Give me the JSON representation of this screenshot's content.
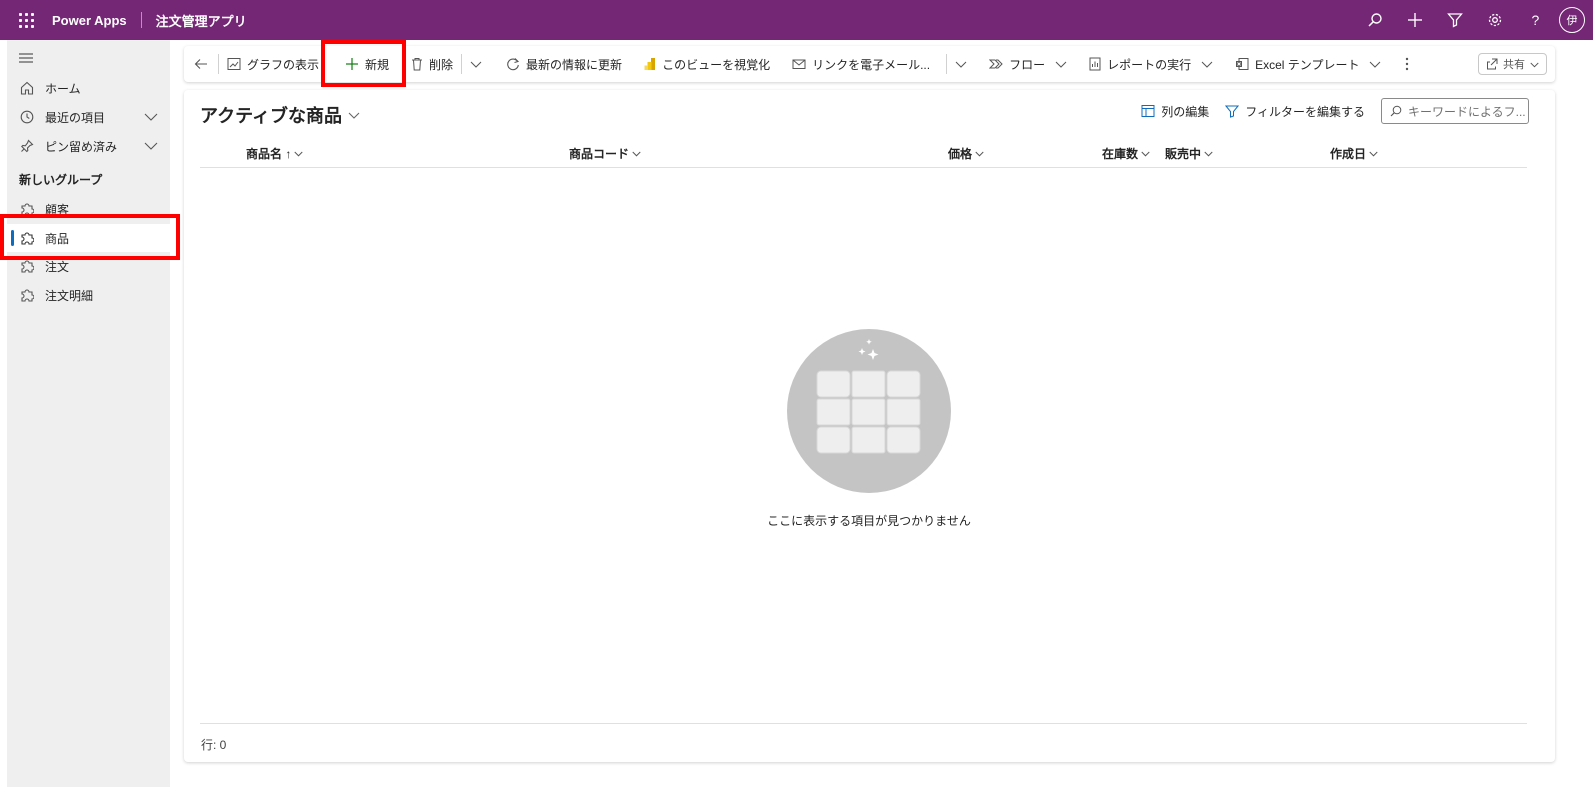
{
  "topbar": {
    "brand": "Power Apps",
    "app_title": "注文管理アプリ",
    "avatar_initial": "伊",
    "color": "#742774"
  },
  "sidebar": {
    "items": [
      {
        "label": "ホーム",
        "icon": "home-icon"
      },
      {
        "label": "最近の項目",
        "icon": "clock-icon"
      },
      {
        "label": "ピン留め済み",
        "icon": "pin-icon"
      }
    ],
    "group_title": "新しいグループ",
    "group_items": [
      {
        "label": "顧客",
        "icon": "puzzle-icon"
      },
      {
        "label": "商品",
        "icon": "puzzle-icon",
        "selected": true
      },
      {
        "label": "注文",
        "icon": "puzzle-icon"
      },
      {
        "label": "注文明細",
        "icon": "puzzle-icon"
      }
    ]
  },
  "command_bar": {
    "show_chart": "グラフの表示",
    "new": "新規",
    "delete": "削除",
    "refresh": "最新の情報に更新",
    "visualize": "このビューを視覚化",
    "email_link": "リンクを電子メール...",
    "flow": "フロー",
    "run_report": "レポートの実行",
    "excel_template": "Excel テンプレート",
    "share": "共有"
  },
  "view": {
    "title": "アクティブな商品",
    "edit_columns": "列の編集",
    "edit_filters": "フィルターを編集する",
    "search_placeholder": "キーワードによるフ...",
    "columns": [
      "商品名 ↑",
      "商品コード",
      "価格",
      "在庫数",
      "販売中",
      "作成日"
    ],
    "empty_message": "ここに表示する項目が見つかりません",
    "row_count": "行: 0"
  }
}
